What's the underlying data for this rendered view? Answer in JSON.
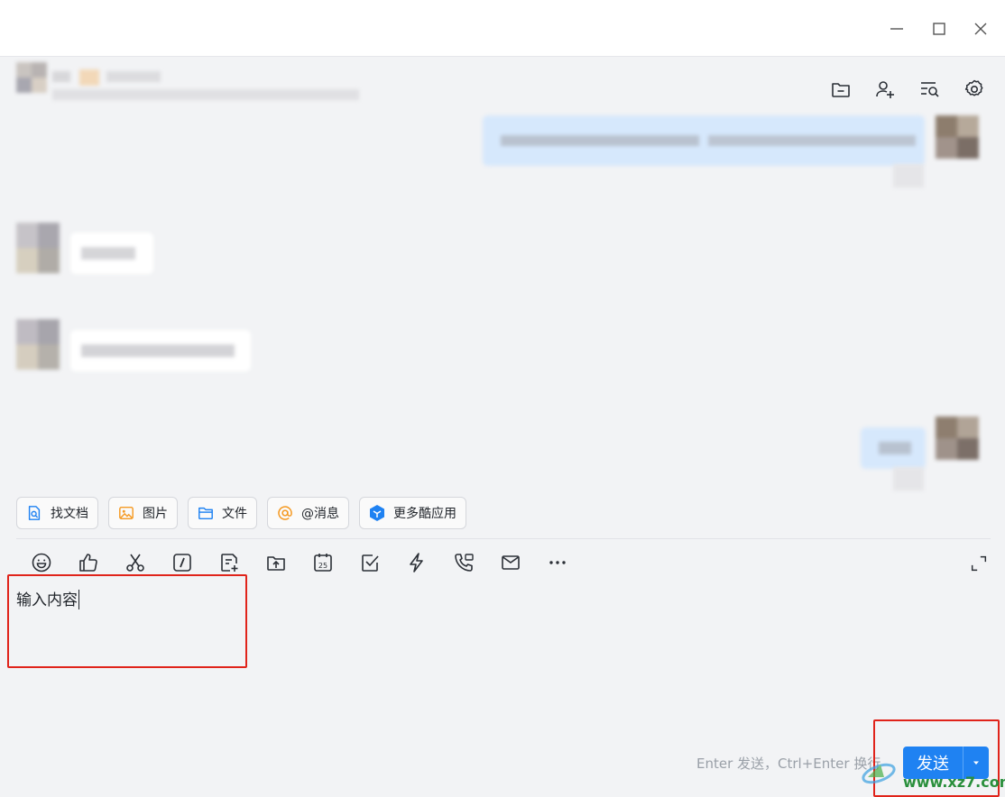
{
  "window": {
    "minimize_icon": "minimize-icon",
    "maximize_icon": "maximize-icon",
    "close_icon": "close-icon"
  },
  "header_icons": [
    "folder-icon",
    "add-member-icon",
    "search-history-icon",
    "settings-icon"
  ],
  "quick_actions": [
    {
      "label": "找文档",
      "icon": "doc-search-icon",
      "color": "#1f82f2"
    },
    {
      "label": "图片",
      "icon": "image-icon",
      "color": "#f59a23"
    },
    {
      "label": "文件",
      "icon": "folder-icon",
      "color": "#1f82f2"
    },
    {
      "label": "@消息",
      "icon": "at-icon",
      "color": "#f59a23"
    },
    {
      "label": "更多酷应用",
      "icon": "apps-icon",
      "color": "#1f82f2"
    }
  ],
  "toolbar_icons": [
    "emoji-icon",
    "thumbs-up-icon",
    "scissors-icon",
    "slash-command-icon",
    "note-add-icon",
    "upload-icon",
    "calendar-icon",
    "task-check-icon",
    "lightning-icon",
    "phone-icon",
    "mail-icon",
    "more-icon"
  ],
  "calendar_day": "25",
  "editor": {
    "text": "输入内容"
  },
  "footer": {
    "hint": "Enter 发送，Ctrl+Enter 换行",
    "send_label": "发送",
    "watermark": "www.xz7.com"
  },
  "colors": {
    "accent": "#1f82f2",
    "highlight_border": "#e0231a"
  }
}
